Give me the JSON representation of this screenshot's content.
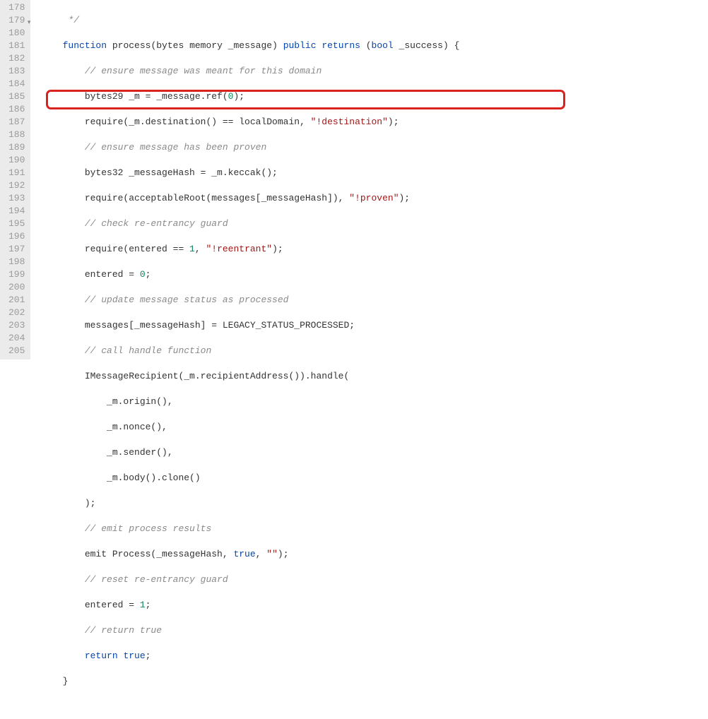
{
  "gutter": {
    "start": 178,
    "end": 205,
    "foldLine": 179
  },
  "code": {
    "l178": "     */",
    "l179_a": "    ",
    "l179_kw1": "function",
    "l179_b": " process(bytes memory _message) ",
    "l179_kw2": "public",
    "l179_c": " ",
    "l179_kw3": "returns",
    "l179_d": " (",
    "l179_kw4": "bool",
    "l179_e": " _success) {",
    "l180": "        // ensure message was meant for this domain",
    "l181_a": "        bytes29 _m = _message.ref(",
    "l181_num": "0",
    "l181_b": ");",
    "l182_a": "        require(_m.destination() == localDomain, ",
    "l182_str": "\"!destination\"",
    "l182_b": ");",
    "l183": "        // ensure message has been proven",
    "l184": "        bytes32 _messageHash = _m.keccak();",
    "l185_a": "        require(acceptableRoot(messages[_messageHash]), ",
    "l185_str": "\"!proven\"",
    "l185_b": ");",
    "l186": "        // check re-entrancy guard",
    "l187_a": "        require(entered == ",
    "l187_num": "1",
    "l187_b": ", ",
    "l187_str": "\"!reentrant\"",
    "l187_c": ");",
    "l188_a": "        entered = ",
    "l188_num": "0",
    "l188_b": ";",
    "l189": "        // update message status as processed",
    "l190": "        messages[_messageHash] = LEGACY_STATUS_PROCESSED;",
    "l191": "        // call handle function",
    "l192": "        IMessageRecipient(_m.recipientAddress()).handle(",
    "l193": "            _m.origin(),",
    "l194": "            _m.nonce(),",
    "l195": "            _m.sender(),",
    "l196": "            _m.body().clone()",
    "l197": "        );",
    "l198": "        // emit process results",
    "l199_a": "        emit Process(_messageHash, ",
    "l199_kw": "true",
    "l199_b": ", ",
    "l199_str": "\"\"",
    "l199_c": ");",
    "l200": "        // reset re-entrancy guard",
    "l201_a": "        entered = ",
    "l201_num": "1",
    "l201_b": ";",
    "l202": "        // return true",
    "l203_a": "        ",
    "l203_kw": "return",
    "l203_b": " ",
    "l203_kw2": "true",
    "l203_c": ";",
    "l204": "    }",
    "l205": ""
  }
}
